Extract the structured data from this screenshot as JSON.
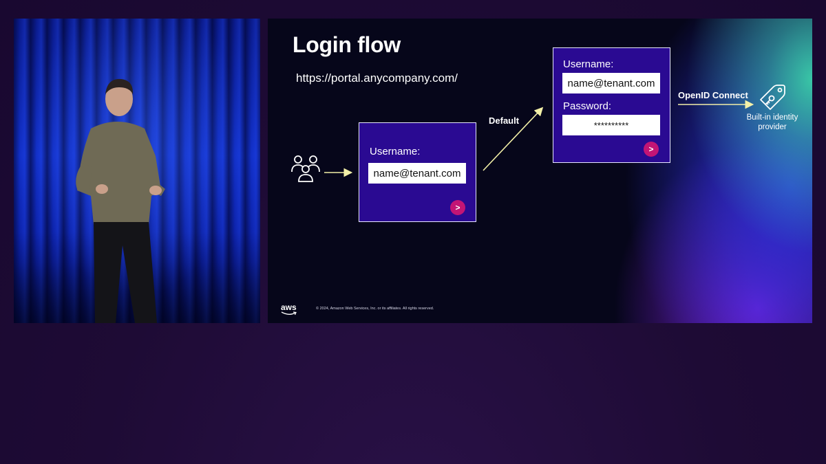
{
  "slide": {
    "title": "Login flow",
    "url": "https://portal.anycompany.com/",
    "first_login": {
      "username_label": "Username:",
      "username_value": "name@tenant.com",
      "submit_glyph": ">"
    },
    "default_label": "Default",
    "second_login": {
      "username_label": "Username:",
      "username_value": "name@tenant.com",
      "password_label": "Password:",
      "password_value": "**********",
      "submit_glyph": ">"
    },
    "protocol_label": "OpenID Connect",
    "idp_label": "Built-in identity provider",
    "footer": {
      "logo": "aws",
      "copyright": "© 2024, Amazon Web Services, Inc. or its affiliates. All rights reserved."
    },
    "icons": {
      "users": "users-group-icon",
      "idp": "key-tag-icon"
    }
  },
  "colors": {
    "login_box_bg": "#2a0a92",
    "submit_button": "#c31575",
    "arrow": "#f3f0a8"
  }
}
